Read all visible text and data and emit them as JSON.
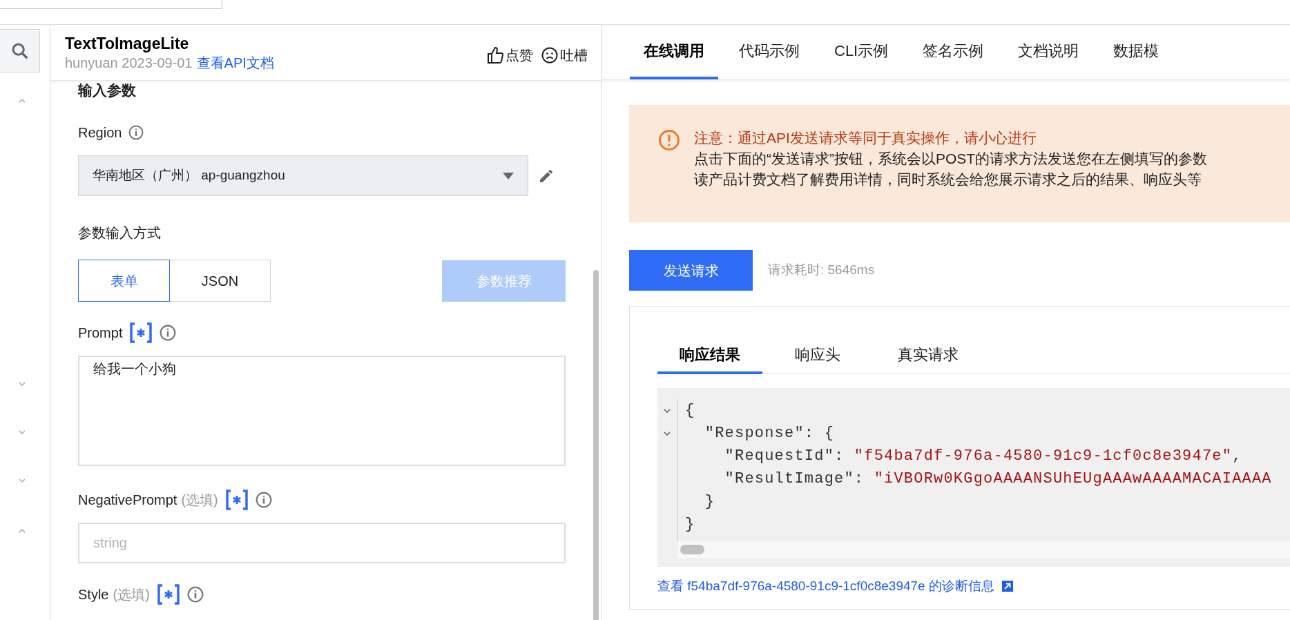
{
  "sidebar": {
    "toggles": [
      {
        "expanded": true
      },
      {
        "expanded": false
      },
      {
        "expanded": false
      },
      {
        "expanded": false
      },
      {
        "expanded": true
      }
    ]
  },
  "header": {
    "title": "TextToImageLite",
    "meta": "hunyuan 2023-09-01",
    "doc_link": "查看API文档",
    "actions": [
      {
        "kind": "like",
        "label": "点赞"
      },
      {
        "kind": "complain",
        "label": "吐槽"
      }
    ]
  },
  "section_title": "输入参数",
  "region": {
    "label": "Region",
    "value": "华南地区（广州） ap-guangzhou"
  },
  "input_mode": {
    "label": "参数输入方式",
    "options": [
      {
        "label": "表单",
        "selected": true
      },
      {
        "label": "JSON",
        "selected": false
      }
    ],
    "recommend": {
      "label": "参数推荐",
      "disabled": true
    }
  },
  "params": [
    {
      "kind": "textarea",
      "name": "Prompt",
      "value": "给我一个小狗"
    },
    {
      "kind": "input",
      "name": "NegativePrompt",
      "optional": "(选填)",
      "placeholder": "string"
    },
    {
      "kind": "label",
      "name": "Style",
      "optional": "(选填)"
    }
  ],
  "tabs": [
    {
      "label": "在线调用",
      "selected": true
    },
    {
      "label": "代码示例",
      "selected": false
    },
    {
      "label": "CLI示例",
      "selected": false
    },
    {
      "label": "签名示例",
      "selected": false
    },
    {
      "label": "文档说明",
      "selected": false
    },
    {
      "label": "数据模",
      "selected": false
    }
  ],
  "notice": {
    "title": "注意：通过API发送请求等同于真实操作，请小心进行",
    "lines": [
      "点击下面的“发送请求”按钮，系统会以POST的请求方法发送您在左侧填写的参数",
      "读产品计费文档了解费用详情，同时系统会给您展示请求之后的结果、响应头等"
    ]
  },
  "send_button": "发送请求",
  "elapsed": "请求耗时: 5646ms",
  "response": {
    "tabs": [
      {
        "label": "响应结果",
        "selected": true
      },
      {
        "label": "响应头",
        "selected": false
      },
      {
        "label": "真实请求",
        "selected": false
      }
    ],
    "code_lines": [
      {
        "foldable": true,
        "parts": [
          {
            "kind": "plain",
            "text": "{"
          }
        ]
      },
      {
        "foldable": true,
        "parts": [
          {
            "kind": "plain",
            "text": "  \"Response\": {"
          }
        ]
      },
      {
        "foldable": false,
        "parts": [
          {
            "kind": "plain",
            "text": "    \"RequestId\": "
          },
          {
            "kind": "string",
            "text": "\"f54ba7df-976a-4580-91c9-1cf0c8e3947e\""
          },
          {
            "kind": "plain",
            "text": ","
          }
        ]
      },
      {
        "foldable": false,
        "parts": [
          {
            "kind": "plain",
            "text": "    \"ResultImage\": "
          },
          {
            "kind": "string",
            "text": "\"iVBORw0KGgoAAAANSUhEUgAAAwAAAAMACAIAAAA"
          }
        ]
      },
      {
        "foldable": false,
        "parts": [
          {
            "kind": "plain",
            "text": "  }"
          }
        ]
      },
      {
        "foldable": false,
        "parts": [
          {
            "kind": "plain",
            "text": "}"
          }
        ]
      }
    ],
    "diagnostic_link": "查看 f54ba7df-976a-4580-91c9-1cf0c8e3947e 的诊断信息"
  }
}
